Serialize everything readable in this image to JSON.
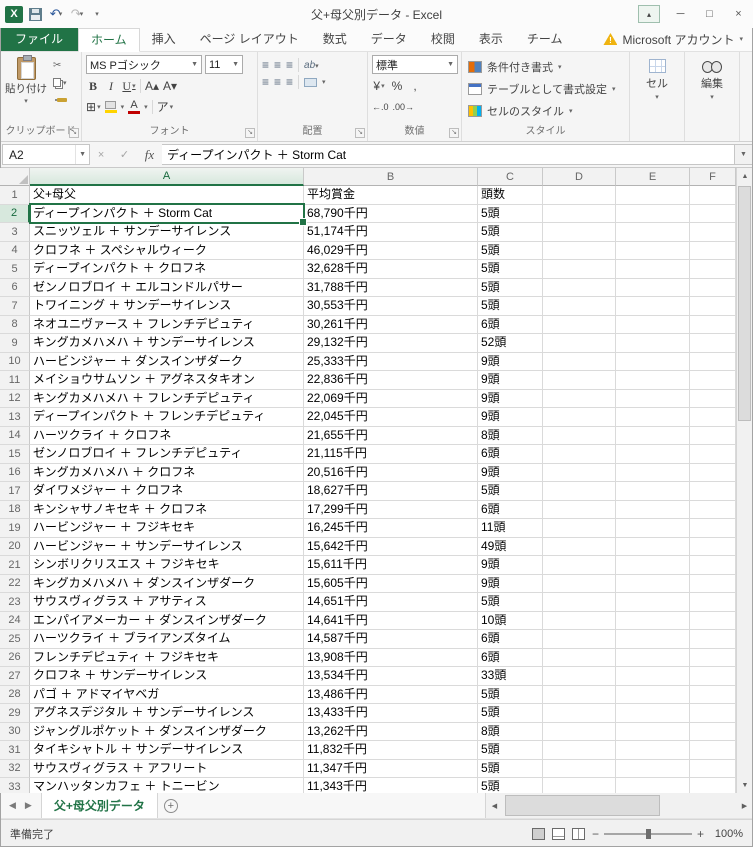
{
  "titlebar": {
    "title": "父+母父別データ - Excel"
  },
  "icons": {
    "excel_logo": "X",
    "undo": "↶",
    "redo": "↷",
    "qat_more": "▾",
    "ribbon_display": "▴",
    "minimize": "─",
    "maximize": "□",
    "close": "×",
    "warning": "!",
    "caret": "▾",
    "dropdown": "▼",
    "scissors": "✂",
    "bold": "B",
    "italic": "I",
    "underline": "U",
    "grow_font": "A▴",
    "shrink_font": "A▾",
    "borders": "⊞",
    "font_color": "A",
    "ruby": "ア",
    "align": "≡",
    "orientation": "ab",
    "currency": "¥",
    "percent": "%",
    "comma": ",",
    "dec_left": "←.0",
    "dec_right": ".00→",
    "cancel": "×",
    "enter": "✓",
    "fx": "fx",
    "nav_left": "◀",
    "nav_right": "▶",
    "scroll_up": "▲",
    "scroll_down": "▼",
    "scroll_left": "◀",
    "scroll_right": "▶",
    "plus": "+",
    "minus": "−",
    "launcher": "↘"
  },
  "ribbon": {
    "file_tab": "ファイル",
    "tabs": [
      "ホーム",
      "挿入",
      "ページ レイアウト",
      "数式",
      "データ",
      "校閲",
      "表示",
      "チーム"
    ],
    "account_label": "Microsoft アカウント",
    "clipboard": {
      "paste": "貼り付け",
      "label": "クリップボード"
    },
    "font": {
      "name": "MS Pゴシック",
      "size": "11",
      "label": "フォント"
    },
    "alignment": {
      "label": "配置"
    },
    "number": {
      "format": "標準",
      "label": "数値"
    },
    "styles": {
      "label": "スタイル",
      "conditional": "条件付き書式",
      "table": "テーブルとして書式設定",
      "cell_styles": "セルのスタイル"
    },
    "cells": {
      "label": "セル"
    },
    "editing": {
      "label": "編集"
    }
  },
  "formula_bar": {
    "name_box": "A2",
    "value": "ディープインパクト ＋ Storm Cat"
  },
  "grid": {
    "columns": [
      "A",
      "B",
      "C",
      "D",
      "E",
      "F"
    ],
    "selected_cell": "A2",
    "rows": [
      [
        "父+母父",
        "平均賞金",
        "頭数"
      ],
      [
        "ディープインパクト ＋ Storm Cat",
        "68,790千円",
        "5頭"
      ],
      [
        "スニッツェル ＋ サンデーサイレンス",
        "51,174千円",
        "5頭"
      ],
      [
        "クロフネ ＋ スペシャルウィーク",
        "46,029千円",
        "5頭"
      ],
      [
        "ディープインパクト ＋ クロフネ",
        "32,628千円",
        "5頭"
      ],
      [
        "ゼンノロブロイ ＋ エルコンドルパサー",
        "31,788千円",
        "5頭"
      ],
      [
        "トワイニング ＋ サンデーサイレンス",
        "30,553千円",
        "5頭"
      ],
      [
        "ネオユニヴァース ＋ フレンチデピュティ",
        "30,261千円",
        "6頭"
      ],
      [
        "キングカメハメハ ＋ サンデーサイレンス",
        "29,132千円",
        "52頭"
      ],
      [
        "ハービンジャー ＋ ダンスインザダーク",
        "25,333千円",
        "9頭"
      ],
      [
        "メイショウサムソン ＋ アグネスタキオン",
        "22,836千円",
        "9頭"
      ],
      [
        "キングカメハメハ ＋ フレンチデピュティ",
        "22,069千円",
        "9頭"
      ],
      [
        "ディープインパクト ＋ フレンチデピュティ",
        "22,045千円",
        "9頭"
      ],
      [
        "ハーツクライ ＋ クロフネ",
        "21,655千円",
        "8頭"
      ],
      [
        "ゼンノロブロイ ＋ フレンチデピュティ",
        "21,115千円",
        "6頭"
      ],
      [
        "キングカメハメハ ＋ クロフネ",
        "20,516千円",
        "9頭"
      ],
      [
        "ダイワメジャー ＋ クロフネ",
        "18,627千円",
        "5頭"
      ],
      [
        "キンシャサノキセキ ＋ クロフネ",
        "17,299千円",
        "6頭"
      ],
      [
        "ハービンジャー ＋ フジキセキ",
        "16,245千円",
        "11頭"
      ],
      [
        "ハービンジャー ＋ サンデーサイレンス",
        "15,642千円",
        "49頭"
      ],
      [
        "シンボリクリスエス ＋ フジキセキ",
        "15,611千円",
        "9頭"
      ],
      [
        "キングカメハメハ ＋ ダンスインザダーク",
        "15,605千円",
        "9頭"
      ],
      [
        "サウスヴィグラス ＋ アサティス",
        "14,651千円",
        "5頭"
      ],
      [
        "エンパイアメーカー ＋ ダンスインザダーク",
        "14,641千円",
        "10頭"
      ],
      [
        "ハーツクライ ＋ ブライアンズタイム",
        "14,587千円",
        "6頭"
      ],
      [
        "フレンチデピュティ ＋ フジキセキ",
        "13,908千円",
        "6頭"
      ],
      [
        "クロフネ ＋ サンデーサイレンス",
        "13,534千円",
        "33頭"
      ],
      [
        "パゴ ＋ アドマイヤベガ",
        "13,486千円",
        "5頭"
      ],
      [
        "アグネスデジタル ＋ サンデーサイレンス",
        "13,433千円",
        "5頭"
      ],
      [
        "ジャングルポケット ＋ ダンスインザダーク",
        "13,262千円",
        "8頭"
      ],
      [
        "タイキシャトル ＋ サンデーサイレンス",
        "11,832千円",
        "5頭"
      ],
      [
        "サウスヴィグラス ＋ アフリート",
        "11,347千円",
        "5頭"
      ],
      [
        "マンハッタンカフェ ＋ トニービン",
        "11,343千円",
        "5頭"
      ]
    ]
  },
  "sheet_bar": {
    "tab": "父+母父別データ"
  },
  "status_bar": {
    "ready": "準備完了",
    "zoom": "100%"
  }
}
